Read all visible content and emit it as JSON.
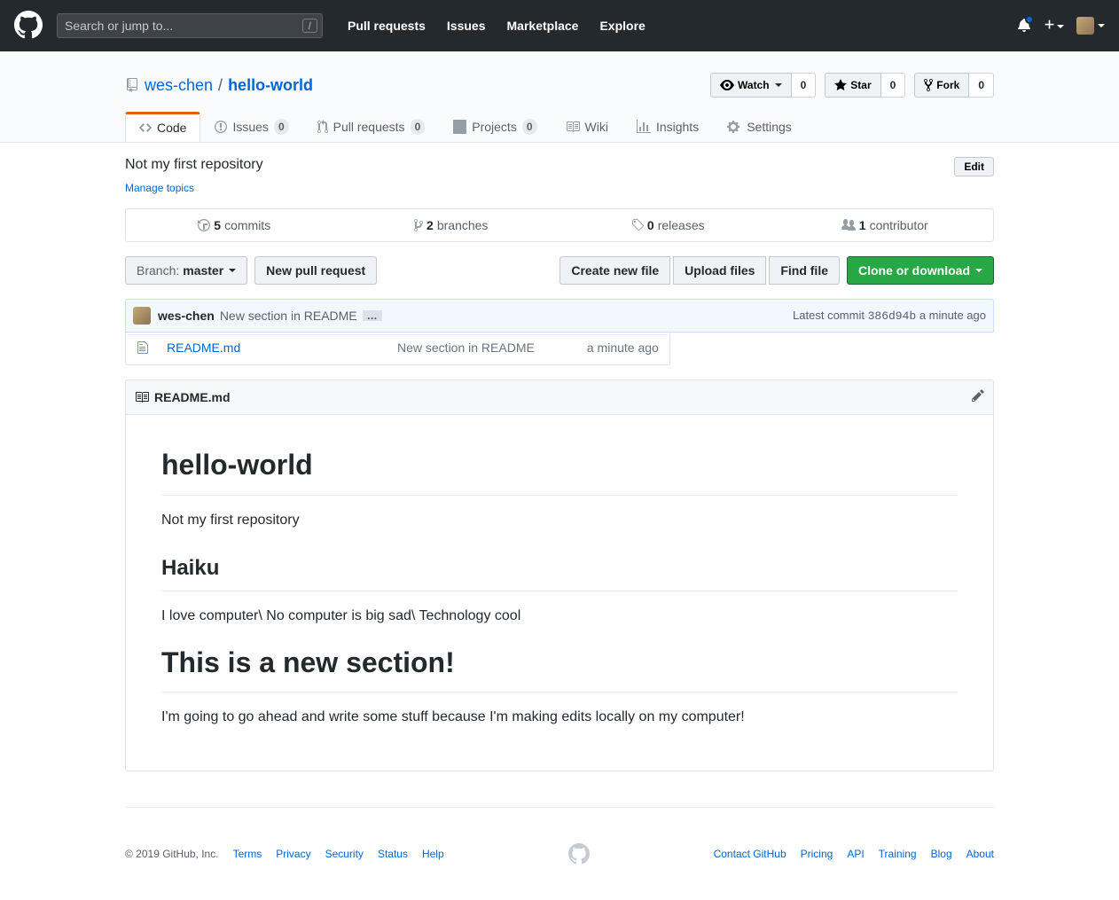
{
  "header": {
    "search_placeholder": "Search or jump to...",
    "nav": {
      "pulls": "Pull requests",
      "issues": "Issues",
      "marketplace": "Marketplace",
      "explore": "Explore"
    }
  },
  "repo": {
    "owner": "wes-chen",
    "name": "hello-world",
    "description": "Not my first repository",
    "manage_topics": "Manage topics",
    "edit_label": "Edit"
  },
  "actions": {
    "watch": {
      "label": "Watch",
      "count": "0"
    },
    "star": {
      "label": "Star",
      "count": "0"
    },
    "fork": {
      "label": "Fork",
      "count": "0"
    }
  },
  "tabs": {
    "code": "Code",
    "issues": {
      "label": "Issues",
      "count": "0"
    },
    "prs": {
      "label": "Pull requests",
      "count": "0"
    },
    "projects": {
      "label": "Projects",
      "count": "0"
    },
    "wiki": "Wiki",
    "insights": "Insights",
    "settings": "Settings"
  },
  "summary": {
    "commits": {
      "num": "5",
      "label": "commits"
    },
    "branches": {
      "num": "2",
      "label": "branches"
    },
    "releases": {
      "num": "0",
      "label": "releases"
    },
    "contributors": {
      "num": "1",
      "label": "contributor"
    }
  },
  "toolbar": {
    "branch_label": "Branch:",
    "branch_name": "master",
    "new_pr": "New pull request",
    "create_file": "Create new file",
    "upload": "Upload files",
    "find": "Find file",
    "clone": "Clone or download"
  },
  "commit": {
    "author": "wes-chen",
    "message": "New section in README",
    "latest_label": "Latest commit",
    "sha": "386d94b",
    "time": "a minute ago"
  },
  "files": [
    {
      "name": "README.md",
      "message": "New section in README",
      "age": "a minute ago"
    }
  ],
  "readme": {
    "filename": "README.md",
    "h1": "hello-world",
    "p1": "Not my first repository",
    "h2a": "Haiku",
    "p2": "I love computer\\ No computer is big sad\\ Technology cool",
    "h1b": "This is a new section!",
    "p3": "I'm going to go ahead and write some stuff because I'm making edits locally on my computer!"
  },
  "footer": {
    "copyright": "© 2019 GitHub, Inc.",
    "left": [
      "Terms",
      "Privacy",
      "Security",
      "Status",
      "Help"
    ],
    "right": [
      "Contact GitHub",
      "Pricing",
      "API",
      "Training",
      "Blog",
      "About"
    ]
  }
}
